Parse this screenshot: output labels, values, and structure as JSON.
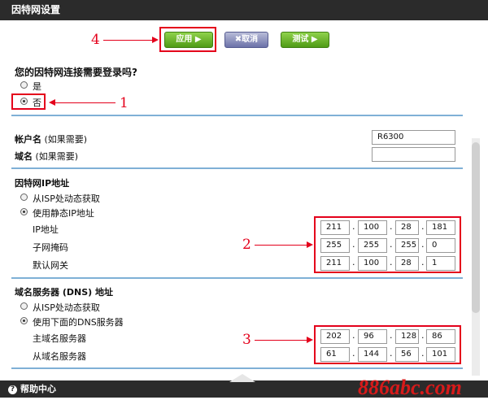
{
  "window": {
    "title": "因特网设置"
  },
  "toolbar": {
    "apply": "应用 ▶",
    "cancel": "✖取消",
    "test": "测试 ▶"
  },
  "annotations": {
    "a1": "1",
    "a2": "2",
    "a3": "3",
    "a4": "4"
  },
  "login": {
    "question": "您的因特网连接需要登录吗?",
    "yes": "是",
    "no": "否",
    "selected": "否"
  },
  "account": {
    "account_label": "帐户名",
    "account_hint": "(如果需要)",
    "account_value": "R6300",
    "domain_label": "域名",
    "domain_hint": "(如果需要)",
    "domain_value": ""
  },
  "ip": {
    "section": "因特网IP地址",
    "dynamic": "从ISP处动态获取",
    "static": "使用静态IP地址",
    "selected": "使用静态IP地址",
    "rows": [
      {
        "label": "IP地址",
        "octets": [
          "211",
          "100",
          "28",
          "181"
        ]
      },
      {
        "label": "子网掩码",
        "octets": [
          "255",
          "255",
          "255",
          "0"
        ]
      },
      {
        "label": "默认网关",
        "octets": [
          "211",
          "100",
          "28",
          "1"
        ]
      }
    ]
  },
  "dns": {
    "section": "域名服务器 (DNS) 地址",
    "dynamic": "从ISP处动态获取",
    "manual": "使用下面的DNS服务器",
    "selected": "使用下面的DNS服务器",
    "rows": [
      {
        "label": "主域名服务器",
        "octets": [
          "202",
          "96",
          "128",
          "86"
        ]
      },
      {
        "label": "从域名服务器",
        "octets": [
          "61",
          "144",
          "56",
          "101"
        ]
      }
    ]
  },
  "footer": {
    "help": "帮助中心"
  },
  "watermark": "886abc.com",
  "colors": {
    "accent_red": "#e4001b",
    "titlebar": "#2b2b2b",
    "divider": "#7fb0d6",
    "apply_green": "#5aa81e"
  }
}
